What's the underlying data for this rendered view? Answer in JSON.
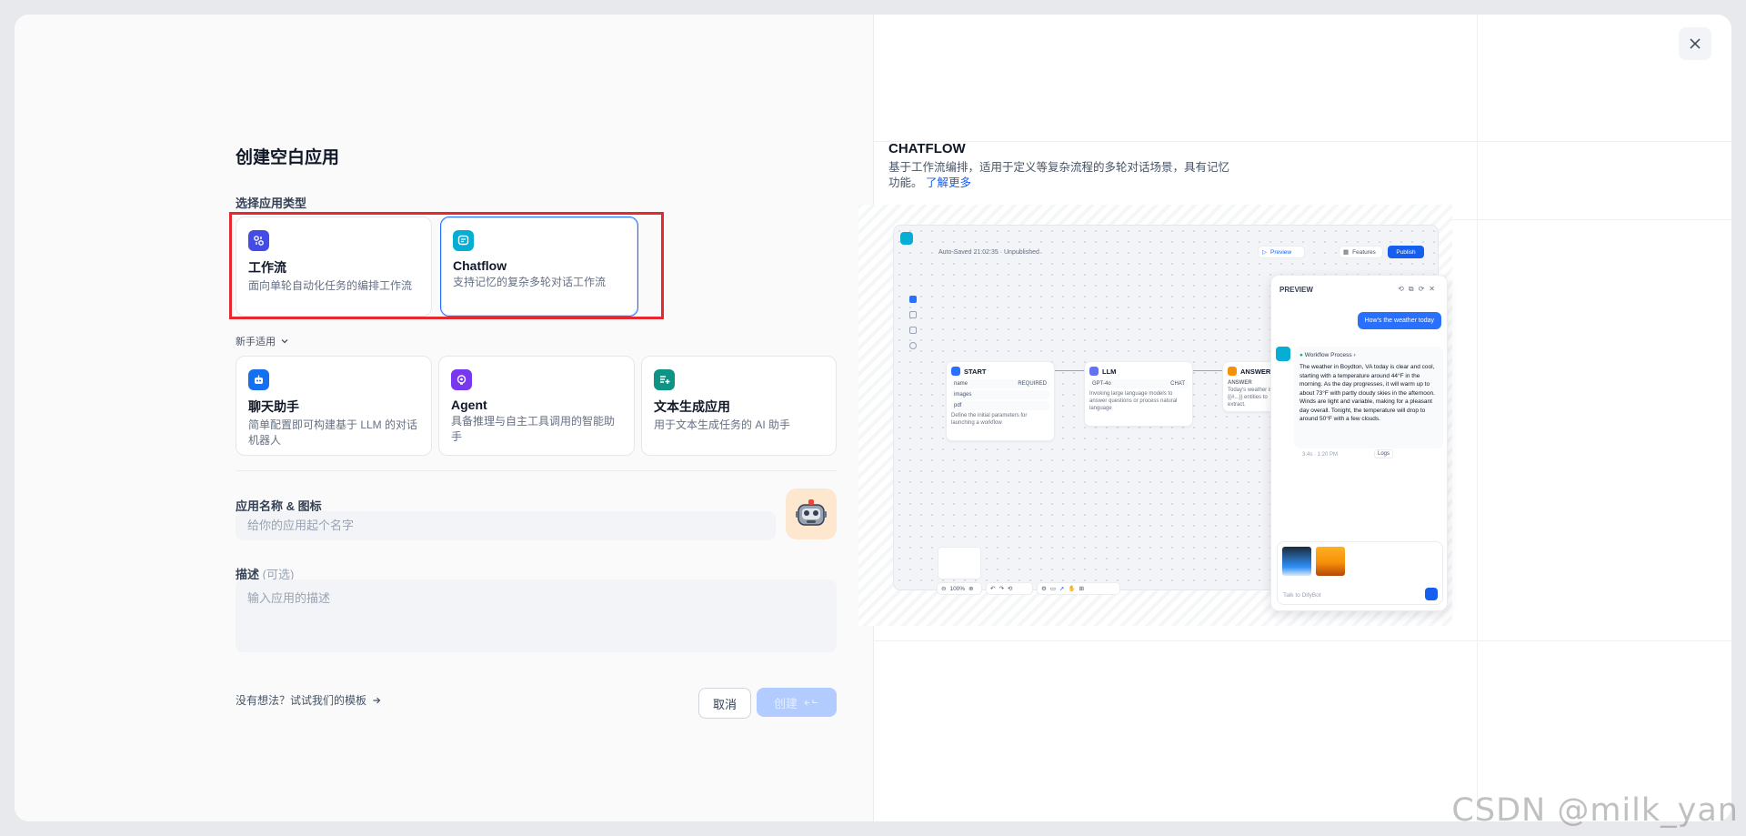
{
  "dialog": {
    "title": "创建空白应用",
    "type_label": "选择应用类型",
    "beginner_toggle": "新手适用",
    "app_types": [
      {
        "title": "工作流",
        "desc": "面向单轮自动化任务的编排工作流",
        "color": "#444ce7"
      },
      {
        "title": "Chatflow",
        "desc": "支持记忆的复杂多轮对话工作流",
        "color": "#06aed4"
      }
    ],
    "beginner_types": [
      {
        "title": "聊天助手",
        "desc": "简单配置即可构建基于 LLM 的对话机器人",
        "color": "#1570ef"
      },
      {
        "title": "Agent",
        "desc": "具备推理与自主工具调用的智能助手",
        "color": "#7839ee"
      },
      {
        "title": "文本生成应用",
        "desc": "用于文本生成任务的 AI 助手",
        "color": "#0e9384"
      }
    ],
    "name_label": "应用名称 & 图标",
    "name_placeholder": "给你的应用起个名字",
    "desc_label": "描述",
    "desc_optional": "(可选)",
    "desc_placeholder": "输入应用的描述",
    "template_link": "没有想法？试试我们的模板",
    "cancel": "取消",
    "create": "创建"
  },
  "info": {
    "title": "CHATFLOW",
    "desc": "基于工作流编排，适用于定义等复杂流程的多轮对话场景，具有记忆功能。",
    "learn_more": "了解更多"
  },
  "preview_shot": {
    "autosave": "Auto-Saved 21:02:35 · Unpublished",
    "preview_btn": "Preview",
    "features_btn": "Features",
    "publish_btn": "Publish",
    "start_node": {
      "title": "START",
      "vars": [
        "name",
        "images",
        "pdf"
      ],
      "required": "REQUIRED",
      "desc": "Define the initial parameters for launching a workflow"
    },
    "llm_node": {
      "title": "LLM",
      "model": "GPT-4o",
      "mode": "CHAT",
      "desc": "Invoking large language models to answer questions or process natural language"
    },
    "answer_node": {
      "title": "ANSWER",
      "label": "ANSWER",
      "desc": "Today's weather is {{#...}} entities to extract."
    },
    "zoom": "100%",
    "panel_title": "PREVIEW",
    "user_msg": "How's the weather today",
    "workflow_process": "Workflow Process",
    "answer_text": "The weather in Boydton, VA today is clear and cool, starting with a temperature around 44°F in the morning. As the day progresses, it will warm up to about 73°F with partly cloudy skies in the afternoon. Winds are light and variable, making for a pleasant day overall. Tonight, the temperature will drop to around 50°F with a few clouds.",
    "meta": "3.4s · 1:20 PM",
    "logs": "Logs",
    "input_placeholder": "Talk to DifyBot"
  },
  "watermark": "CSDN @milk_yan"
}
